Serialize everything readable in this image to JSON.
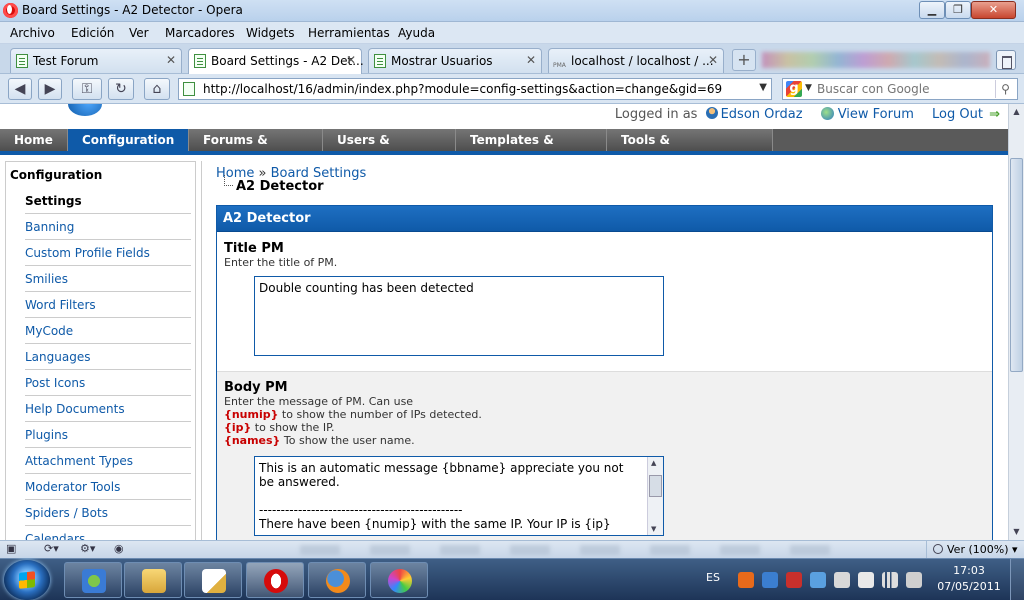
{
  "window": {
    "title": "Board Settings - A2 Detector - Opera",
    "min_label": "▁",
    "max_label": "❐",
    "close_label": "✕"
  },
  "menu": [
    "Archivo",
    "Edición",
    "Ver",
    "Marcadores",
    "Widgets",
    "Herramientas",
    "Ayuda"
  ],
  "tabs": [
    {
      "label": "Test Forum"
    },
    {
      "label": "Board Settings - A2 Det..."
    },
    {
      "label": "Mostrar Usuarios"
    },
    {
      "label": "localhost / localhost / ..."
    }
  ],
  "tab_close": "✕",
  "address": {
    "url": "http://localhost/16/admin/index.php?module=config-settings&action=change&gid=69"
  },
  "search": {
    "placeholder": "Buscar con Google"
  },
  "header": {
    "logged_in_as": "Logged in as",
    "username": "Edson Ordaz",
    "view_forum": "View Forum",
    "log_out": "Log Out"
  },
  "main_nav": [
    "Home",
    "Configuration",
    "Forums & Posts",
    "Users & Groups",
    "Templates & Style",
    "Tools & Maintenance"
  ],
  "sidebar": {
    "heading": "Configuration",
    "items": [
      {
        "label": "Settings"
      },
      {
        "label": "Banning"
      },
      {
        "label": "Custom Profile Fields"
      },
      {
        "label": "Smilies"
      },
      {
        "label": "Word Filters"
      },
      {
        "label": "MyCode"
      },
      {
        "label": "Languages"
      },
      {
        "label": "Post Icons"
      },
      {
        "label": "Help Documents"
      },
      {
        "label": "Plugins"
      },
      {
        "label": "Attachment Types"
      },
      {
        "label": "Moderator Tools"
      },
      {
        "label": "Spiders / Bots"
      },
      {
        "label": "Calendars"
      }
    ]
  },
  "breadcrumb": {
    "home": "Home",
    "separator": "»",
    "board_settings": "Board Settings",
    "current": "A2 Detector"
  },
  "panel": {
    "title": "A2 Detector",
    "title_pm": {
      "label": "Title PM",
      "description": "Enter the title of PM.",
      "value": "Double counting has been detected"
    },
    "body_pm": {
      "label": "Body PM",
      "description": "Enter the message of PM. Can use",
      "var_numip": "{numip}",
      "desc_numip": " to show the number of IPs detected.",
      "var_ip": "{ip}",
      "desc_ip": " to show the IP.",
      "var_names": "{names}",
      "desc_names": " To show the user name.",
      "value": "This is an automatic message {bbname} appreciate you not be answered.\n\n-----------------------------------------------\nThere have been {numip} with the same IP. Your IP is {ip}"
    }
  },
  "statusbar": {
    "zoom": "Ver (100%)"
  },
  "taskbar": {
    "language": "ES",
    "time": "17:03",
    "date": "07/05/2011"
  }
}
